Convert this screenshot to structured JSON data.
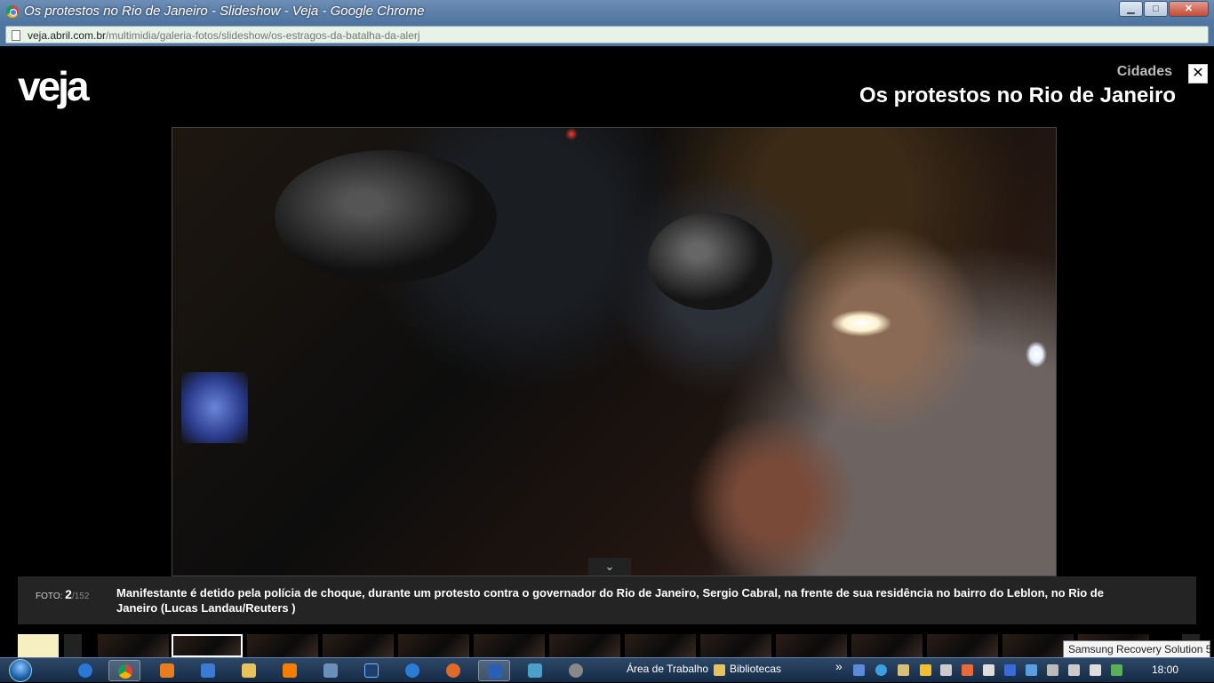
{
  "window": {
    "title": "Os protestos no Rio de Janeiro - Slideshow - Veja - Google Chrome",
    "minimize_label": "▁",
    "maximize_label": "□",
    "close_label": "✕"
  },
  "address": {
    "host": "veja.abril.com.br",
    "path": "/multimidia/galeria-fotos/slideshow/os-estragos-da-batalha-da-alerj"
  },
  "page": {
    "logo": "veja",
    "section": "Cidades",
    "title": "Os protestos no Rio de Janeiro",
    "close_label": "✕",
    "expand_label": "⌄",
    "photo_counter": {
      "label": "FOTO:",
      "current": "2",
      "total": "/152"
    },
    "caption": "Manifestante é detido pela polícia de choque, durante um protesto contra o governador do Rio de Janeiro, Sergio Cabral, na frente de sua residência no bairro do Leblon, no Rio de Janeiro (Lucas Landau/Reuters )"
  },
  "tooltip": "Samsung Recovery Solution 5",
  "taskbar": {
    "desktop_label": "Área de Trabalho",
    "libraries_label": "Bibliotecas",
    "overflow_label": "»",
    "clock": "18:00"
  },
  "icons": {
    "start": "windows-start-orb",
    "ie": "internet-explorer-icon",
    "chrome": "chrome-icon",
    "media": "media-player-icon",
    "explorer": "folder-icon",
    "blogger": "blogger-icon",
    "photoshop": "photoshop-icon",
    "word": "word-icon"
  }
}
